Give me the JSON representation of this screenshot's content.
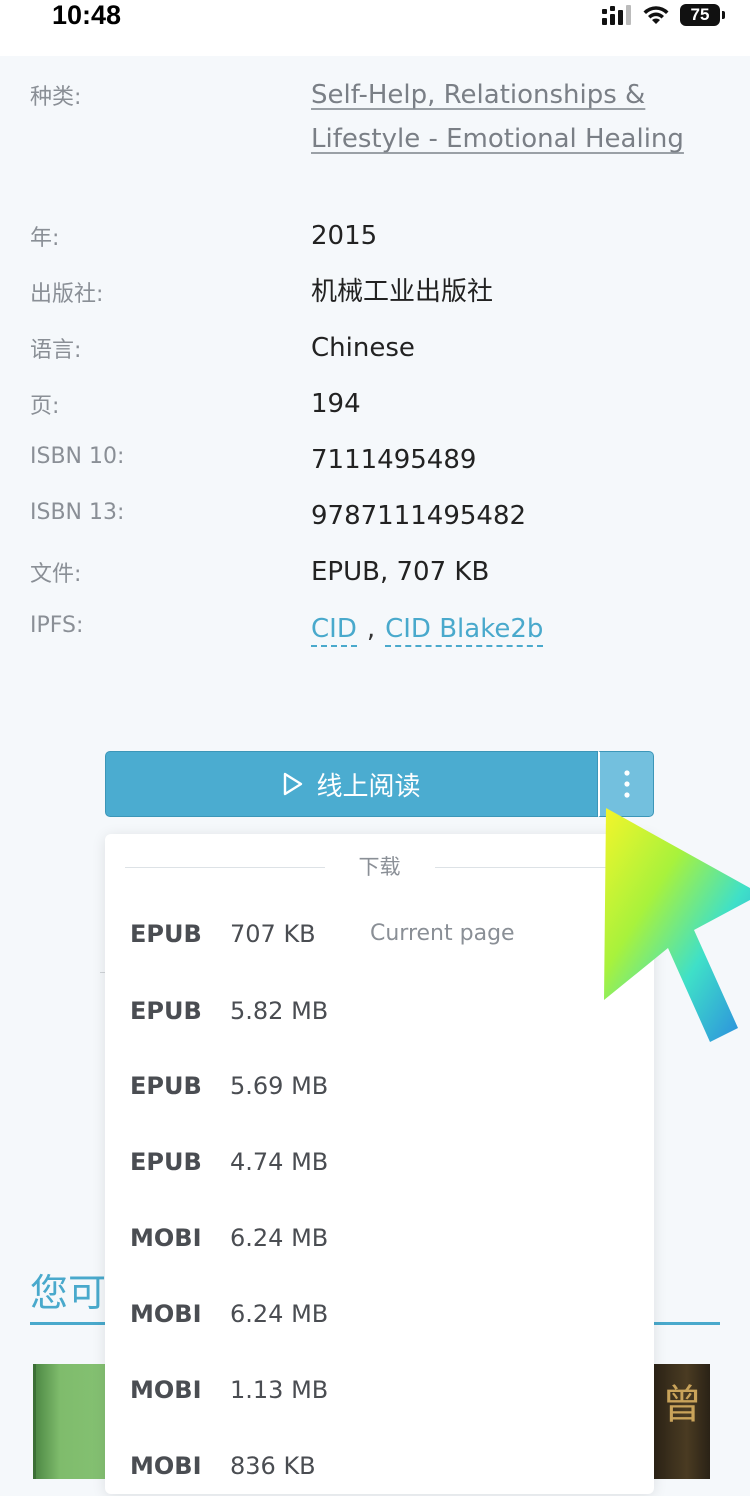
{
  "status_bar": {
    "time": "10:48",
    "battery": "75"
  },
  "details": [
    {
      "label": "种类:",
      "value": "Self-Help, Relationships & Lifestyle - Emotional Healing",
      "type": "link"
    },
    {
      "label": "年:",
      "value": "2015"
    },
    {
      "label": "出版社:",
      "value": "机械工业出版社"
    },
    {
      "label": "语言:",
      "value": "Chinese"
    },
    {
      "label": "页:",
      "value": "194"
    },
    {
      "label": "ISBN 10:",
      "value": "7111495489"
    },
    {
      "label": "ISBN 13:",
      "value": "9787111495482"
    },
    {
      "label": "文件:",
      "value": "EPUB, 707 KB"
    },
    {
      "label": "IPFS:",
      "links": [
        "CID",
        "CID Blake2b"
      ],
      "separator": ","
    }
  ],
  "read_button": {
    "label": "线上阅读"
  },
  "download_menu": {
    "header": "下载",
    "items": [
      {
        "format": "EPUB",
        "size": "707 KB",
        "note": "Current page"
      },
      {
        "format": "EPUB",
        "size": "5.82 MB"
      },
      {
        "format": "EPUB",
        "size": "5.69 MB"
      },
      {
        "format": "EPUB",
        "size": "4.74 MB"
      },
      {
        "format": "MOBI",
        "size": "6.24 MB"
      },
      {
        "format": "MOBI",
        "size": "6.24 MB"
      },
      {
        "format": "MOBI",
        "size": "1.13 MB"
      },
      {
        "format": "MOBI",
        "size": "836 KB"
      }
    ]
  },
  "background_section": {
    "title_partial": "您可"
  },
  "book_right_glyph": "曾",
  "colors": {
    "accent": "#49a9cc",
    "button": "#4bacd0",
    "button_more": "#73c0de"
  }
}
